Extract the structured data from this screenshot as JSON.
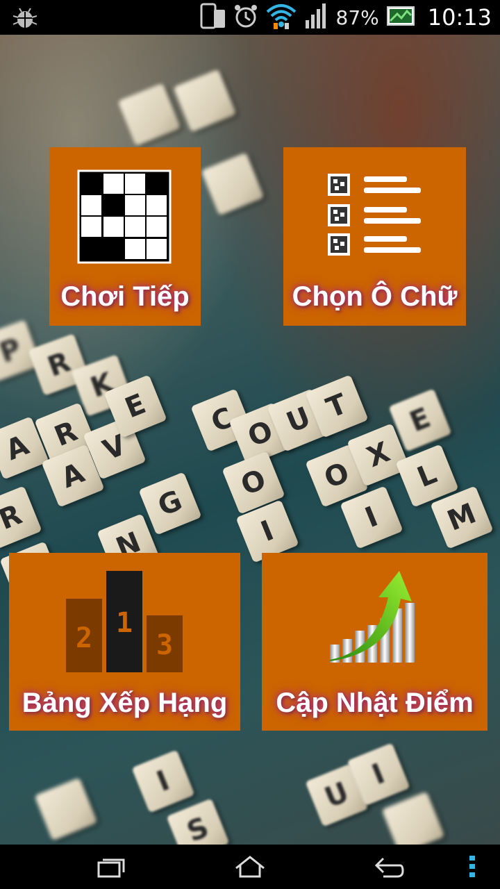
{
  "status_bar": {
    "battery_percent": "87%",
    "time": "10:13",
    "icons": [
      "debug-icon",
      "phone-icon",
      "alarm-icon",
      "wifi-icon",
      "signal-icon",
      "battery-icon",
      "image-icon"
    ]
  },
  "menu": {
    "continue_label": "Chơi Tiếp",
    "choose_label": "Chọn Ô Chữ",
    "leaderboard_label": "Bảng Xếp Hạng",
    "update_label": "Cập Nhật Điểm"
  },
  "nav_bar": {
    "icons": [
      "recent-apps-icon",
      "home-icon",
      "back-icon",
      "overflow-menu-icon"
    ]
  },
  "colors": {
    "tile_orange": "#cc6400",
    "label_glow": "#b03070"
  }
}
